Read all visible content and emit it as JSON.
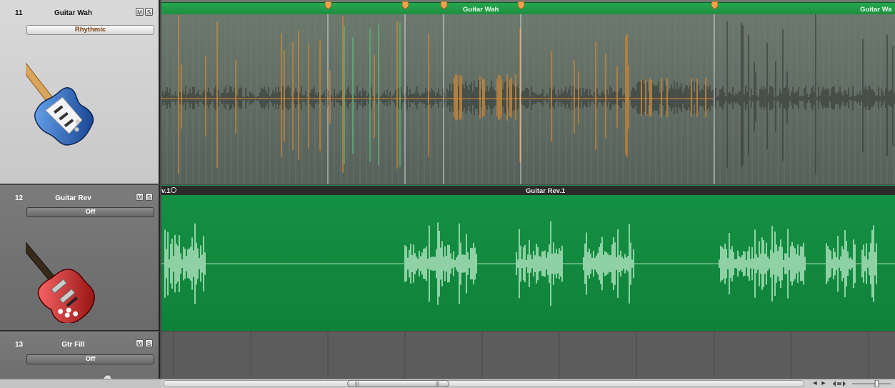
{
  "tracks": [
    {
      "number": "11",
      "name": "Guitar Wah",
      "mute": "M",
      "solo": "S",
      "preset": "Rhythmic"
    },
    {
      "number": "12",
      "name": "Guitar Rev",
      "mute": "M",
      "solo": "S",
      "preset": "Off"
    },
    {
      "number": "13",
      "name": "Gtr Fill",
      "mute": "M",
      "solo": "S",
      "preset": "Off"
    }
  ],
  "regions": {
    "guitar_wah": {
      "title_a": "Guitar Wah",
      "title_b": "Guitar Wa"
    },
    "guitar_rev": {
      "title_left": "v.1",
      "title_main": "Guitar Rev.1"
    }
  },
  "icons": {
    "track11": "blue-electric-guitar-icon",
    "track12": "red-electric-guitar-icon",
    "track13": "guitar-icon",
    "scroll_left": "arrow-left-icon",
    "scroll_right": "arrow-right-icon",
    "zoom": "zoom-icon"
  },
  "colors": {
    "region_green": "#1d8e40",
    "waveform_orange": "#e0892a",
    "waveform_green": "#57c27a",
    "waveform_dark": "#363b38",
    "rev_wave": "#8fd1a5"
  },
  "scrollbar": {
    "thumb_grip_left": "|||",
    "thumb_grip_right": "|||"
  }
}
